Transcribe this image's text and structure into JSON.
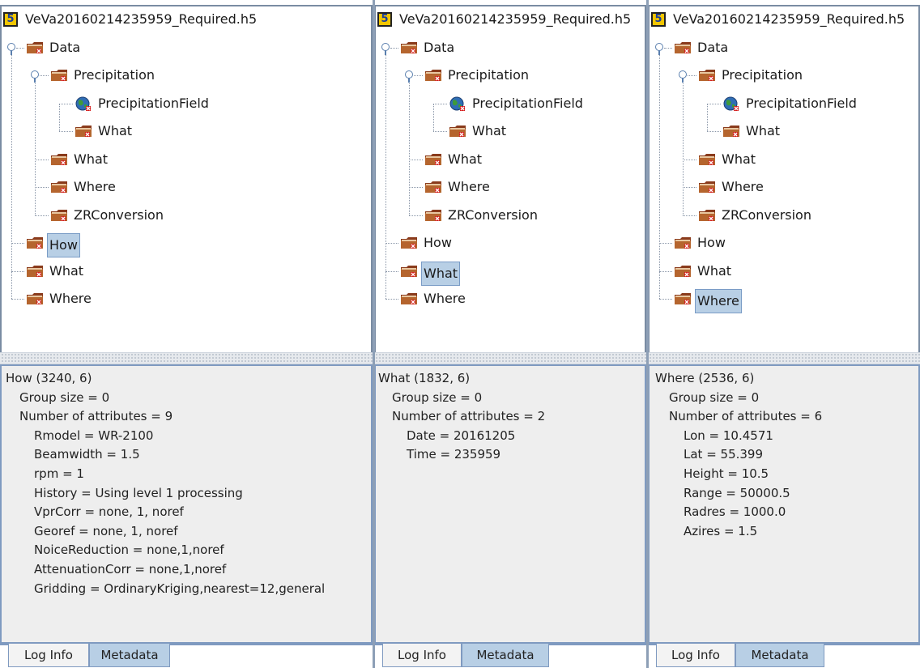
{
  "file_title": "VeVa20160214235959_Required.h5",
  "file_icon_glyph": "5",
  "panels": [
    {
      "tree": {
        "root": "VeVa20160214235959_Required.h5",
        "data": "Data",
        "precipitation": "Precipitation",
        "precip_field": "PrecipitationField",
        "precip_what": "What",
        "data_what": "What",
        "data_where": "Where",
        "zr": "ZRConversion",
        "how": "How",
        "what": "What",
        "where": "Where",
        "selected": "How"
      },
      "meta_lines": [
        "How (3240, 6)",
        "Group size = 0",
        "Number of attributes = 9",
        "Rmodel = WR-2100",
        "Beamwidth = 1.5",
        "rpm = 1",
        "History = Using level 1 processing",
        "VprCorr = none, 1, noref",
        "Georef = none, 1, noref",
        "NoiceReduction = none,1,noref",
        "AttenuationCorr = none,1,noref",
        "Gridding = OrdinaryKriging,nearest=12,general"
      ],
      "tabs": [
        "Log Info",
        "Metadata"
      ]
    },
    {
      "tree": {
        "root": "VeVa20160214235959_Required.h5",
        "data": "Data",
        "precipitation": "Precipitation",
        "precip_field": "PrecipitationField",
        "precip_what": "What",
        "data_what": "What",
        "data_where": "Where",
        "zr": "ZRConversion",
        "how": "How",
        "what": "What",
        "where": "Where",
        "selected": "What"
      },
      "meta_lines": [
        "What (1832, 6)",
        "Group size = 0",
        "Number of attributes = 2",
        "Date = 20161205",
        "Time = 235959"
      ],
      "tabs": [
        "Log Info",
        "Metadata"
      ]
    },
    {
      "tree": {
        "root": "VeVa20160214235959_Required.h5",
        "data": "Data",
        "precipitation": "Precipitation",
        "precip_field": "PrecipitationField",
        "precip_what": "What",
        "data_what": "What",
        "data_where": "Where",
        "zr": "ZRConversion",
        "how": "How",
        "what": "What",
        "where": "Where",
        "selected": "Where"
      },
      "meta_lines": [
        "Where (2536, 6)",
        "Group size = 0",
        "Number of attributes = 6",
        "Lon = 10.4571",
        "Lat = 55.399",
        "Height = 10.5",
        "Range = 50000.5",
        "Radres = 1000.0",
        "Azires = 1.5"
      ],
      "tabs": [
        "Log Info",
        "Metadata"
      ]
    }
  ],
  "colors": {
    "selection": "#b8cfe5",
    "active_tab": "#b8cfe5",
    "folder": "#a0522d",
    "dataset_globe": "#2f6db5",
    "h5_badge": "#f2c600"
  },
  "icons": {
    "root": "hdf5-file-icon",
    "group": "folder-group-icon",
    "dataset": "image-dataset-icon",
    "expand": "tree-expand-icon"
  }
}
